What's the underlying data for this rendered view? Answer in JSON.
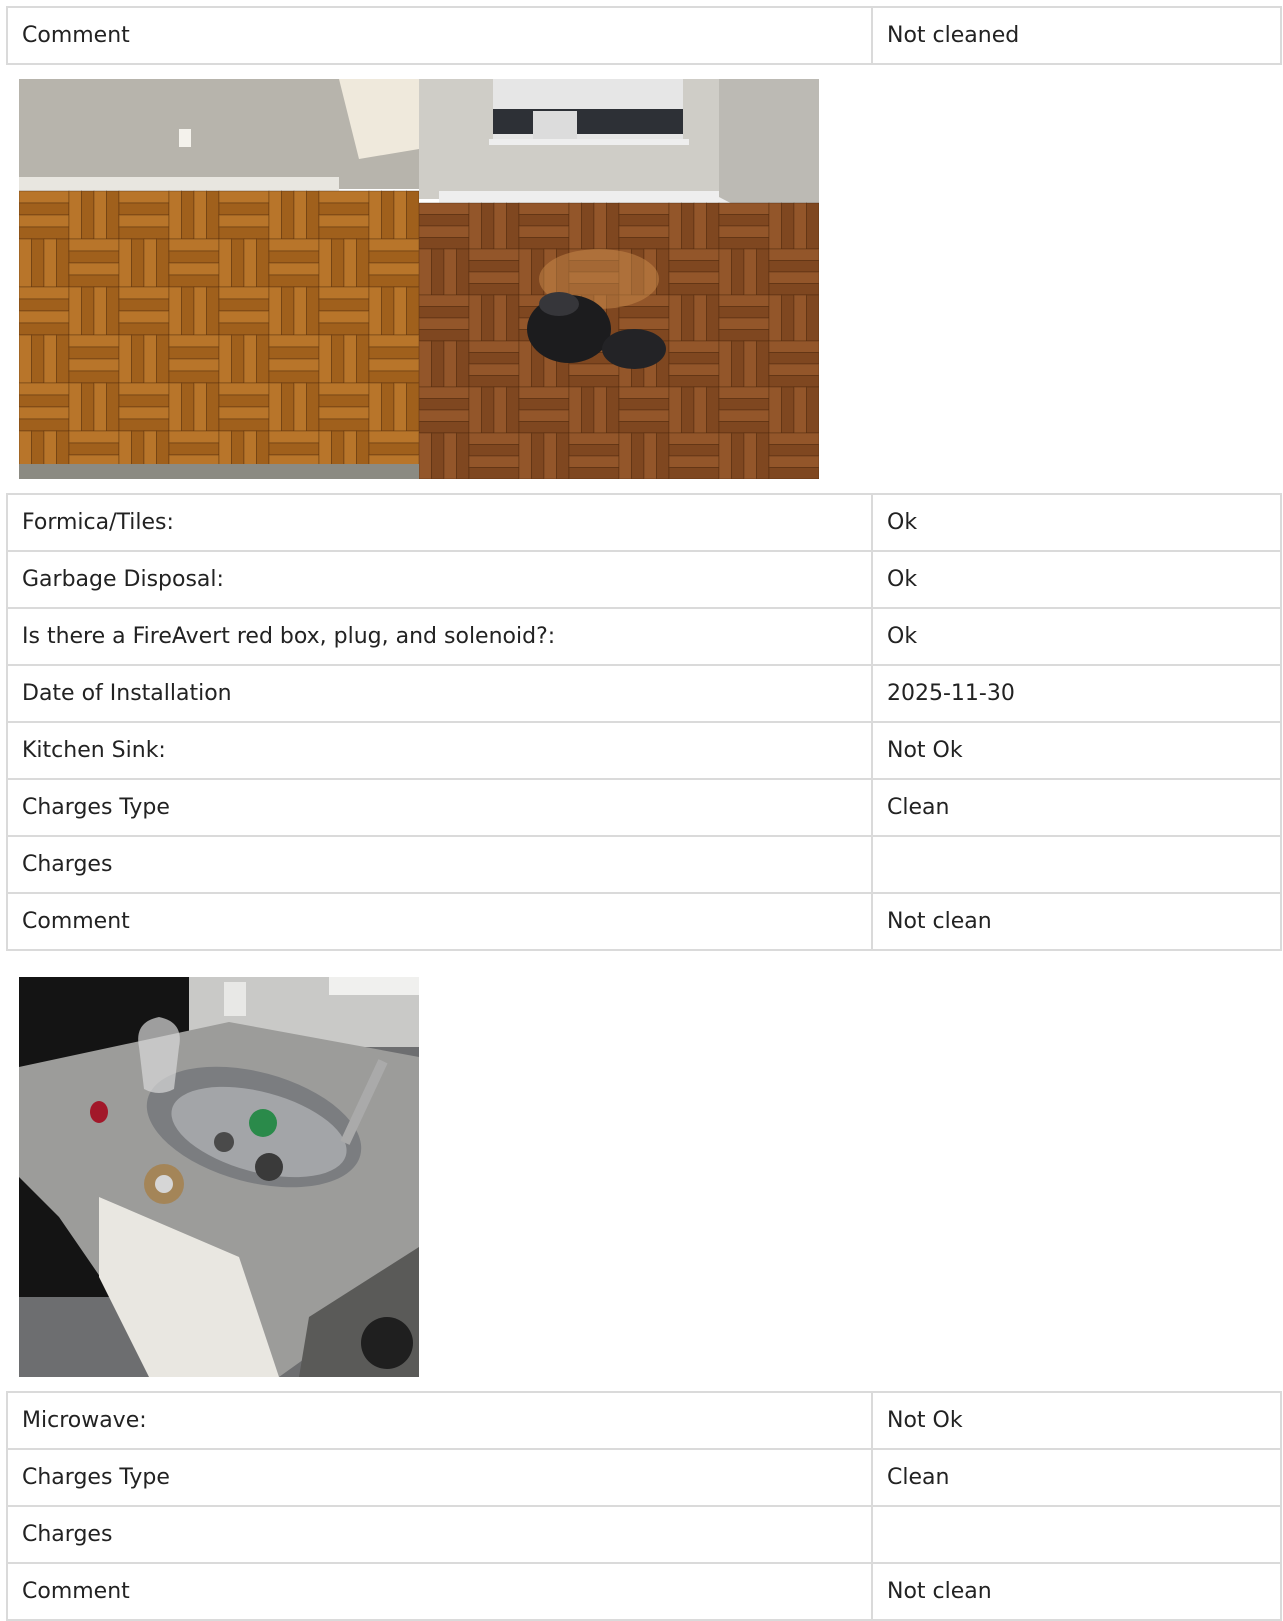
{
  "rows_group1": [
    {
      "label": "Comment",
      "value": "Not cleaned"
    }
  ],
  "photos_group1": [
    {
      "icon": "photo-parquet-floor-corner"
    },
    {
      "icon": "photo-room-with-window-and-trash-bag"
    }
  ],
  "rows_group2": [
    {
      "label": "Formica/Tiles:",
      "value": "Ok"
    },
    {
      "label": "Garbage Disposal:",
      "value": "Ok"
    },
    {
      "label": "Is there a FireAvert red box, plug, and solenoid?:",
      "value": "Ok"
    },
    {
      "label": "Date of Installation",
      "value": "2025-11-30"
    },
    {
      "label": "Kitchen Sink:",
      "value": "Not Ok"
    },
    {
      "label": "Charges Type",
      "value": "Clean"
    },
    {
      "label": "Charges",
      "value": ""
    },
    {
      "label": "Comment",
      "value": "Not clean"
    }
  ],
  "photos_group2": [
    {
      "icon": "photo-kitchen-sink-counter"
    }
  ],
  "rows_group3": [
    {
      "label": "Microwave:",
      "value": "Not Ok"
    },
    {
      "label": "Charges Type",
      "value": "Clean"
    },
    {
      "label": "Charges",
      "value": ""
    },
    {
      "label": "Comment",
      "value": "Not clean"
    }
  ]
}
